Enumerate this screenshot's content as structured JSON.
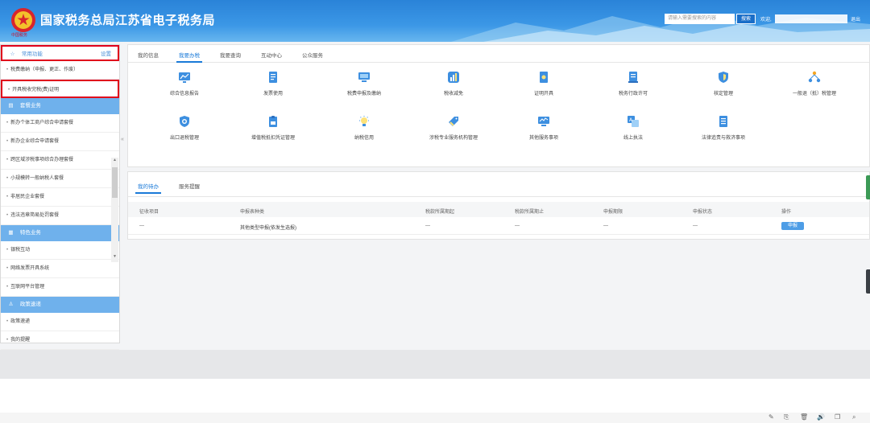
{
  "header": {
    "title": "国家税务总局江苏省电子税务局",
    "logo_sub": "中国税务",
    "search_placeholder": "请输入需要搜索的内容",
    "search_button": "搜索",
    "welcome": "欢迎,",
    "logout": "退出"
  },
  "sidebar": {
    "common": {
      "label": "常用功能",
      "settings": "设置",
      "icon": "star-icon"
    },
    "common_items": [
      "税费缴纳（申报、更正、作废）",
      "开具税收完税(费)证明"
    ],
    "package": {
      "label": "套餐业务",
      "icon": "stack-icon"
    },
    "package_items": [
      "新办个体工商户综合申请套餐",
      "新办企业综合申请套餐",
      "跨区域涉税事项综合办理套餐",
      "小规模转一般纳税人套餐",
      "非居民企业套餐",
      "违法违章简易处罚套餐"
    ],
    "feature": {
      "label": "特色业务",
      "icon": "grid-icon"
    },
    "feature_items": [
      "银税互动",
      "网络发票开具系统",
      "互联网平台管理"
    ],
    "policy": {
      "label": "政策速递",
      "icon": "person-icon"
    },
    "policy_items": [
      "政策速递",
      "我的提醒"
    ]
  },
  "main": {
    "tabs": [
      "我的信息",
      "我要办税",
      "我要查询",
      "互动中心",
      "公众服务"
    ],
    "active_tab": 1,
    "functions_row1": [
      "综合信息报告",
      "发票使用",
      "税费申报及缴纳",
      "税收减免",
      "证明开具",
      "税务行政许可",
      "核定管理",
      "一般退（抵）税管理"
    ],
    "functions_row2": [
      "出口退税管理",
      "增值税抵扣凭证管理",
      "纳税信用",
      "涉税专业服务机构管理",
      "其他服务事项",
      "线上执法",
      "法律追责与救济事项"
    ]
  },
  "tasks": {
    "tabs": [
      "我的待办",
      "服务提醒"
    ],
    "headers": [
      "征收项目",
      "申报表种类",
      "税款所属期起",
      "税款所属期止",
      "申报期限",
      "申报状态",
      "操作"
    ],
    "row": [
      "---",
      "其他类型申报(依发生选报)",
      "---",
      "---",
      "---",
      "---"
    ],
    "action": "申报"
  },
  "toolbar_icons": [
    "paint-icon",
    "copy-icon",
    "trash-icon",
    "speaker-icon",
    "window-icon",
    "search-icon"
  ],
  "colors": {
    "accent": "#1a7ad8",
    "section": "#6fb1ec",
    "highlight": "#e0001b"
  }
}
